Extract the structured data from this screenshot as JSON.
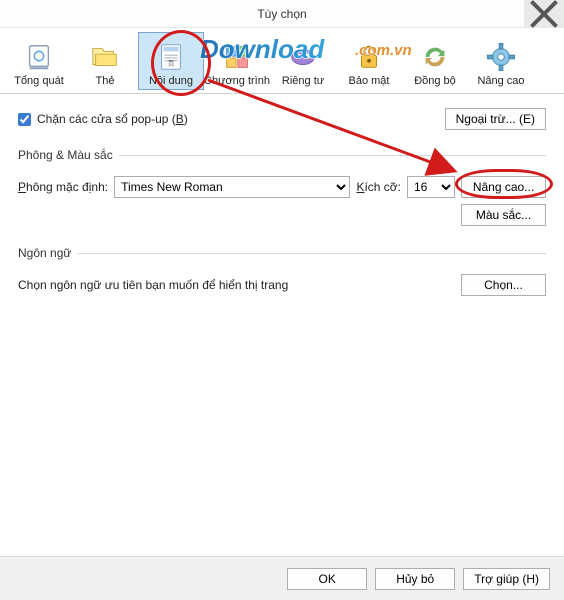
{
  "window": {
    "title": "Tùy chọn"
  },
  "toolbar": {
    "items": [
      {
        "label": "Tổng quát",
        "name": "tab-general"
      },
      {
        "label": "Thẻ",
        "name": "tab-tabs"
      },
      {
        "label": "Nội dung",
        "name": "tab-content"
      },
      {
        "label": "Chương trình",
        "name": "tab-programs"
      },
      {
        "label": "Riêng tư",
        "name": "tab-privacy"
      },
      {
        "label": "Bảo mật",
        "name": "tab-security"
      },
      {
        "label": "Đồng bộ",
        "name": "tab-sync"
      },
      {
        "label": "Nâng cao",
        "name": "tab-advanced"
      }
    ]
  },
  "popup": {
    "checkbox_label_prefix": "Chặn các cửa sổ pop-up (",
    "checkbox_hotkey": "B",
    "checkbox_label_suffix": ")",
    "excluding_button": "Ngoại trừ... (E)",
    "checked": true
  },
  "fonts": {
    "section_title": "Phông & Màu sắc",
    "default_font_label_prefix": "Phông mặc định:",
    "default_font_hotkey": "P",
    "font_value": "Times New Roman",
    "size_label_prefix": "Kích cỡ:",
    "size_hotkey": "K",
    "size_value": "16",
    "advanced_button": "Nâng cao...",
    "colors_button": "Màu sắc..."
  },
  "language": {
    "section_title": "Ngôn ngữ",
    "text": "Chọn ngôn ngữ ưu tiên bạn muốn để hiển thị trang",
    "choose_button": "Chọn..."
  },
  "footer": {
    "ok": "OK",
    "cancel": "Hủy bỏ",
    "help": "Trợ giúp (H)"
  }
}
